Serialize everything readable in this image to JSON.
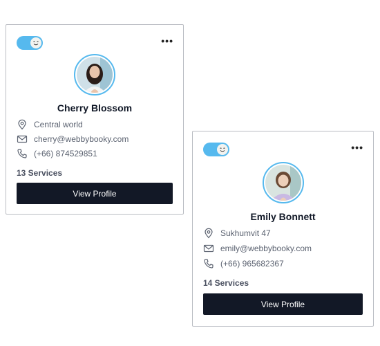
{
  "cards": [
    {
      "name": "Cherry Blossom",
      "location": "Central world",
      "email": "cherry@webbybooky.com",
      "phone": "(+66) 874529851",
      "services": "13 Services",
      "button_label": "View Profile",
      "menu_label": "•••"
    },
    {
      "name": "Emily Bonnett",
      "location": "Sukhumvit 47",
      "email": "emily@webbybooky.com",
      "phone": "(+66) 965682367",
      "services": "14 Services",
      "button_label": "View Profile",
      "menu_label": "•••"
    }
  ],
  "icons": {
    "toggle": "smiley-toggle-icon",
    "location": "map-pin-icon",
    "email": "envelope-icon",
    "phone": "phone-icon",
    "menu": "more-dots-icon"
  },
  "colors": {
    "accent": "#56b9ee",
    "button_bg": "#121826",
    "name_text": "#111827",
    "info_text": "#5b6270"
  }
}
